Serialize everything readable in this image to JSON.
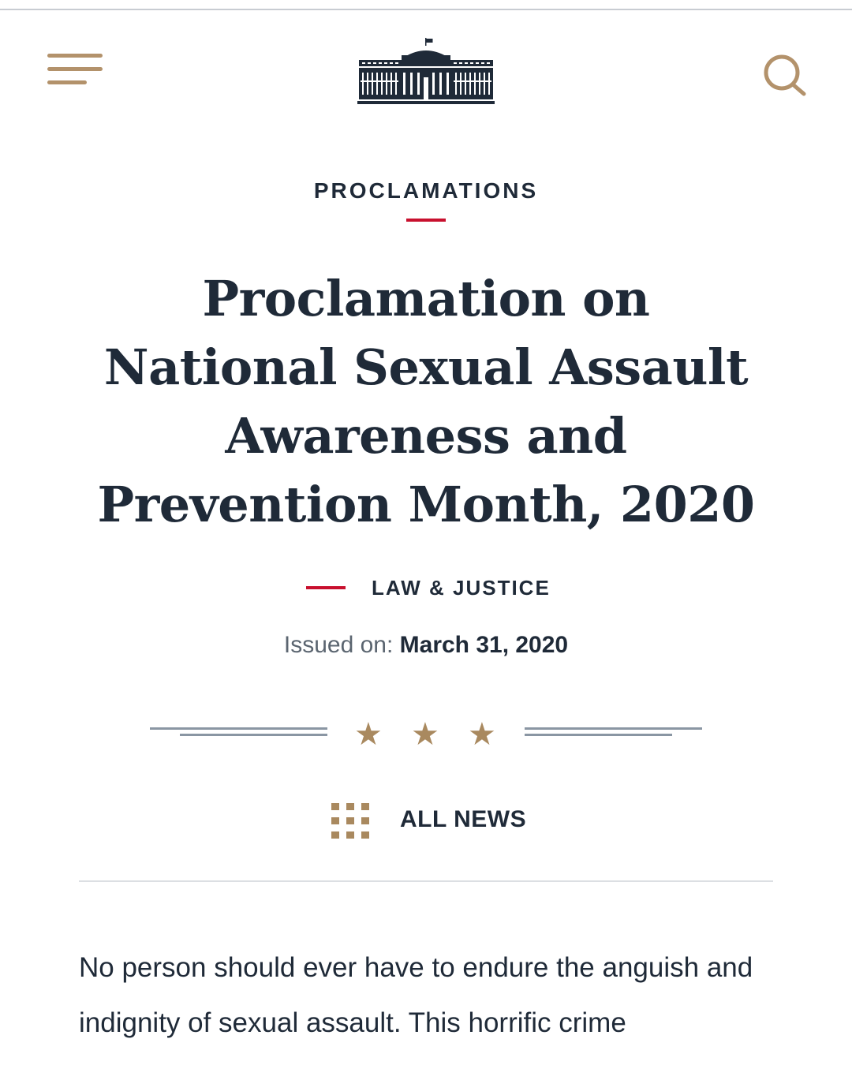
{
  "header": {
    "menu_icon": "hamburger-menu-icon",
    "logo_icon": "white-house-logo",
    "search_icon": "search-icon"
  },
  "article": {
    "category": "PROCLAMATIONS",
    "title": "Proclamation on National Sexual Assault Awareness and Prevention Month, 2020",
    "topic": "LAW & JUSTICE",
    "issued_label": "Issued on:",
    "issued_date": "March 31, 2020",
    "all_news": "ALL NEWS",
    "body": "No person should ever have to endure the anguish and indignity of sexual assault.  This horrific crime"
  },
  "colors": {
    "accent_gold": "#a9895f",
    "accent_red": "#c8102e",
    "text_navy": "#1f2a38"
  }
}
